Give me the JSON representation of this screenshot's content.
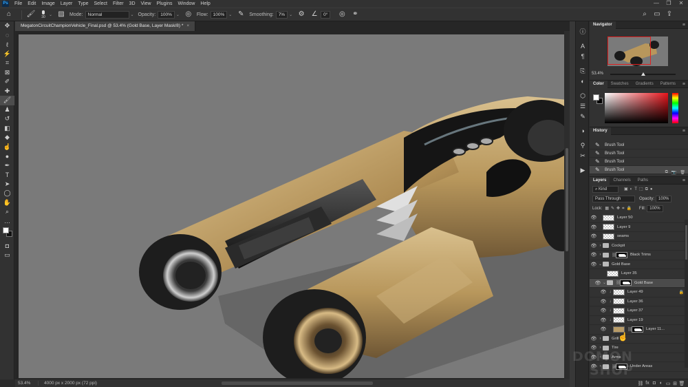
{
  "menu": {
    "logo": "Ps",
    "items": [
      "File",
      "Edit",
      "Image",
      "Layer",
      "Type",
      "Select",
      "Filter",
      "3D",
      "View",
      "Plugins",
      "Window",
      "Help"
    ]
  },
  "window_controls": {
    "minimize": "—",
    "restore": "❐",
    "close": "✕"
  },
  "options": {
    "brush_size": "30",
    "mode_label": "Mode:",
    "mode_value": "Normal",
    "opacity_label": "Opacity:",
    "opacity_value": "100%",
    "flow_label": "Flow:",
    "flow_value": "100%",
    "smoothing_label": "Smoothing:",
    "smoothing_value": "7%",
    "angle_value": "0°"
  },
  "document": {
    "tab_title": "MegatonCircuitChampionVehicle_Final.psd @ 53.4% (Gold Base, Layer Mask/8) *",
    "close": "×"
  },
  "status": {
    "zoom": "53.4%",
    "info": "4000 px x 2000 px (72 ppi)"
  },
  "navigator": {
    "tab": "Navigator",
    "zoom": "53.4%"
  },
  "color_panel": {
    "tabs": [
      "Color",
      "Swatches",
      "Gradients",
      "Patterns"
    ]
  },
  "history": {
    "tab": "History",
    "rows": [
      "Brush Tool",
      "Brush Tool",
      "Brush Tool",
      "Brush Tool"
    ]
  },
  "layers_panel": {
    "tabs": [
      "Layers",
      "Channels",
      "Paths"
    ],
    "kind_filter": "Kind",
    "blend_mode": "Pass Through",
    "opacity_label": "Opacity:",
    "opacity_value": "100%",
    "lock_label": "Lock:",
    "fill_label": "Fill:",
    "fill_value": "100%",
    "layers": [
      {
        "name": "Layer 50"
      },
      {
        "name": "Layer 9"
      },
      {
        "name": "seams"
      },
      {
        "name": "Cockpit"
      },
      {
        "name": "Black Trims"
      },
      {
        "name": "Gold Base"
      },
      {
        "name": "Layer 35"
      },
      {
        "name": "Gold Base"
      },
      {
        "name": "Layer 49"
      },
      {
        "name": "Layer 36"
      },
      {
        "name": "Layer 37"
      },
      {
        "name": "Layer 19"
      },
      {
        "name": "Layer 11..."
      },
      {
        "name": "Grill"
      },
      {
        "name": "Tire"
      },
      {
        "name": "Arms"
      },
      {
        "name": "Under Areas"
      }
    ]
  },
  "watermark": {
    "line1": "DOMON",
    "line2": "SHOP"
  }
}
